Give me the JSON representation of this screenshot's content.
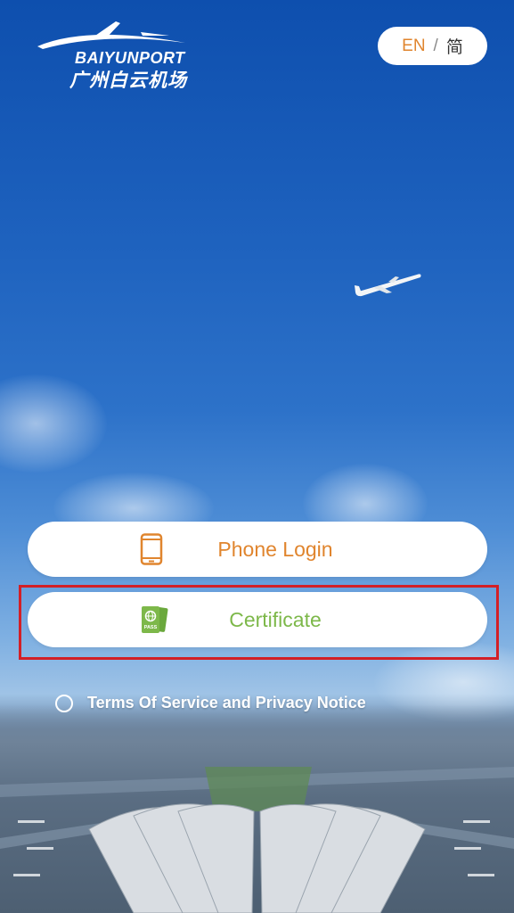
{
  "brand": {
    "name_en": "BAIYUNPORT",
    "name_cn": "广州白云机场"
  },
  "language": {
    "english": "EN",
    "separator": "/",
    "chinese": "简"
  },
  "login": {
    "phone_label": "Phone Login",
    "certificate_label": "Certificate",
    "certificate_icon_text": "PASS"
  },
  "terms": {
    "label": "Terms Of Service and Privacy Notice",
    "checked": false
  },
  "colors": {
    "accent_orange": "#e0852e",
    "accent_green": "#7db84a",
    "highlight_red": "#d31f26"
  },
  "icons": {
    "phone": "phone-icon",
    "certificate": "passport-icon",
    "logo": "airplane-swoosh-logo"
  }
}
